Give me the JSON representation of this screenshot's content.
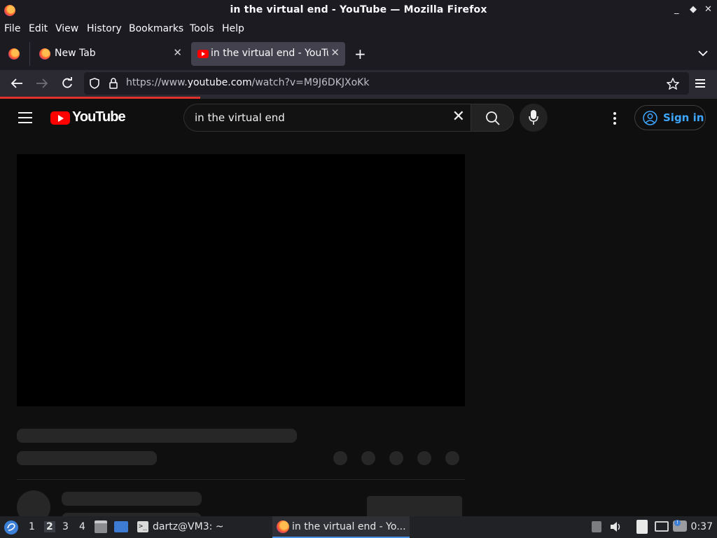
{
  "window": {
    "title": "in the virtual end - YouTube — Mozilla Firefox",
    "controls": [
      "_",
      "◆",
      "✕"
    ]
  },
  "menubar": {
    "items": [
      "File",
      "Edit",
      "View",
      "History",
      "Bookmarks",
      "Tools",
      "Help"
    ]
  },
  "tabs": [
    {
      "label": "New Tab",
      "favicon": "firefox-icon",
      "active": false
    },
    {
      "label": "in the virtual end - YouTube",
      "favicon": "youtube-icon",
      "active": true
    }
  ],
  "addressbar": {
    "url_prefix": "https://www.",
    "url_domain": "youtube.com",
    "url_path": "/watch?v=M9J6DKJXoKk"
  },
  "youtube": {
    "logo_text": "YouTube",
    "search_value": "in the virtual end",
    "signin_label": "Sign in"
  },
  "taskbar": {
    "workspaces": [
      "1",
      "2",
      "3",
      "4"
    ],
    "active_workspace": "2",
    "tasks": [
      {
        "label": "dartz@VM3: ~",
        "icon": "terminal-icon"
      },
      {
        "label": "in the virtual end - Yo...",
        "icon": "firefox-icon"
      }
    ],
    "clock": "0:37"
  },
  "colors": {
    "youtube_red": "#ff0000",
    "signin_blue": "#3ea6ff",
    "loading_bar": "#e0312a"
  }
}
